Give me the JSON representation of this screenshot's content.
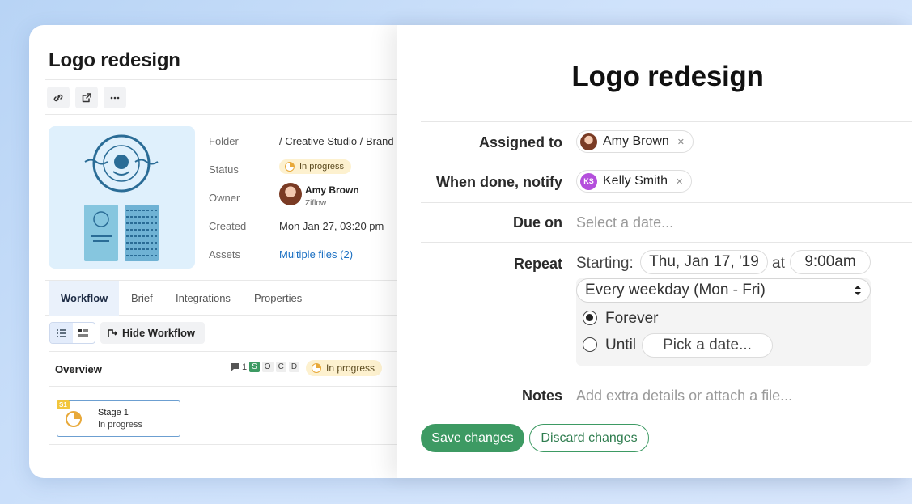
{
  "left": {
    "title": "Logo redesign",
    "toolbar": [
      {
        "icon": "link-icon"
      },
      {
        "icon": "share-icon"
      },
      {
        "icon": "more-icon"
      }
    ],
    "meta": {
      "folder_label": "Folder",
      "folder_value": "/ Creative Studio / Brand",
      "status_label": "Status",
      "status_value": "In progress",
      "owner_label": "Owner",
      "owner_name": "Amy Brown",
      "owner_org": "Ziflow",
      "created_label": "Created",
      "created_value": "Mon Jan 27, 03:20 pm",
      "assets_label": "Assets",
      "assets_value": "Multiple files (2)"
    },
    "tabs": [
      "Workflow",
      "Brief",
      "Integrations",
      "Properties"
    ],
    "hide_workflow_label": "Hide Workflow",
    "overview": {
      "label": "Overview",
      "comment_count": "1",
      "stage_letters": [
        "S",
        "O",
        "C",
        "D"
      ],
      "status": "In progress"
    },
    "stage": {
      "tag": "S1",
      "name": "Stage 1",
      "status": "In progress"
    }
  },
  "panel": {
    "title": "Logo redesign",
    "assigned_label": "Assigned to",
    "assigned_name": "Amy Brown",
    "notify_label": "When done, notify",
    "notify_initials": "KS",
    "notify_name": "Kelly Smith",
    "due_label": "Due on",
    "due_placeholder": "Select a date...",
    "repeat_label": "Repeat",
    "starting_label": "Starting:",
    "start_date": "Thu, Jan 17, '19",
    "at_label": "at",
    "start_time": "9:00am",
    "frequency": "Every weekday (Mon - Fri)",
    "forever_label": "Forever",
    "until_label": "Until",
    "until_placeholder": "Pick a date...",
    "notes_label": "Notes",
    "notes_placeholder": "Add extra details or attach a file...",
    "save_label": "Save changes",
    "discard_label": "Discard changes"
  },
  "colors": {
    "accent_green": "#3d9a63",
    "status_yellow": "#fdf1cf",
    "link_blue": "#1a6fc2"
  }
}
